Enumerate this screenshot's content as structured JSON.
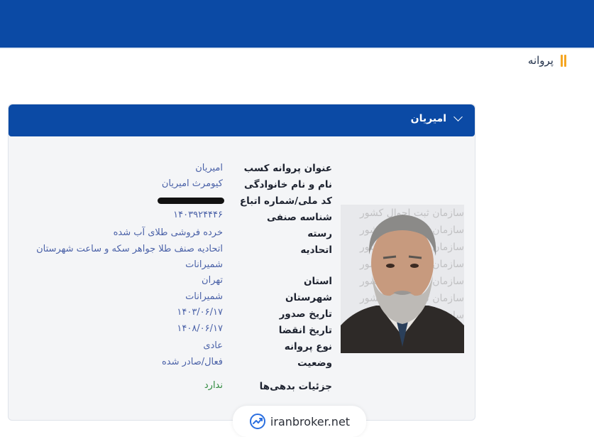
{
  "header": {
    "brand_color": "#0b4aa5"
  },
  "page": {
    "title": "پروانه",
    "accent_color": "#f5a623"
  },
  "card": {
    "title": "امیریان",
    "expand_icon": "chevron-down-icon",
    "photo_watermark": "سازمان ثبت احوال کشور",
    "fields": [
      {
        "label": "عنوان پروانه کسب",
        "value": "امیریان"
      },
      {
        "label": "نام و نام خانوادگی",
        "value": "کیومرث امیریان"
      },
      {
        "label": "کد ملی/شماره اتباع",
        "value": ""
      },
      {
        "label": "شناسه صنفی",
        "value": "۱۴۰۳۹۲۴۴۴۶"
      },
      {
        "label": "رسته",
        "value": "خرده فروشی طلای آب شده"
      },
      {
        "label": "اتحادیه",
        "value": "اتحادیه صنف طلا جواهر سکه و ساعت شهرستان",
        "value_cont": "شمیرانات"
      },
      {
        "label": "استان",
        "value": "تهران"
      },
      {
        "label": "شهرستان",
        "value": "شمیرانات"
      },
      {
        "label": "تاریخ صدور",
        "value": "۱۴۰۳/۰۶/۱۷"
      },
      {
        "label": "تاریخ انقضا",
        "value": "۱۴۰۸/۰۶/۱۷"
      },
      {
        "label": "نوع پروانه",
        "value": "عادی"
      },
      {
        "label": "وضعیت",
        "value": "فعال/صادر شده"
      },
      {
        "label": "جزئیات بدهی‌ها",
        "value": "ندارد"
      }
    ]
  },
  "footer": {
    "brand": "iranbroker.net",
    "brand_icon": "trend-chart-icon"
  }
}
